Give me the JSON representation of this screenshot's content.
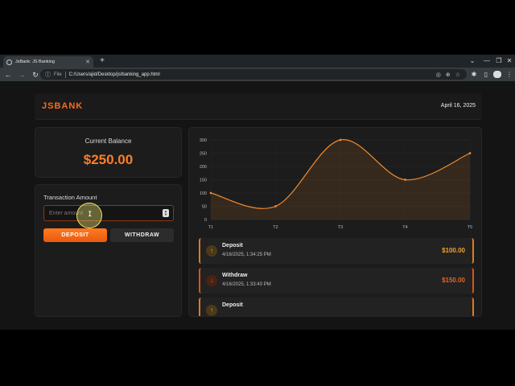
{
  "browser": {
    "tab_title": "JsBank: JS Banking",
    "scheme": "File",
    "url": "C:/Users/ajid/Desktop/js/banking_app.html"
  },
  "header": {
    "brand": "JSBANK",
    "date": "April 16, 2025"
  },
  "balance": {
    "label": "Current Balance",
    "value": "$250.00"
  },
  "transaction_form": {
    "label": "Transaction Amount",
    "placeholder": "Enter amount",
    "deposit_label": "DEPOSIT",
    "withdraw_label": "WITHDRAW"
  },
  "chart_data": {
    "type": "line",
    "x": [
      "T1",
      "T2",
      "T3",
      "T4",
      "T5"
    ],
    "values": [
      100,
      50,
      300,
      150,
      250
    ],
    "yticks": [
      "0",
      "50",
      "100",
      "150",
      "200",
      "250",
      "300"
    ],
    "ylim": [
      0,
      300
    ],
    "grid": true,
    "color": "#f08a2e"
  },
  "transactions": [
    {
      "type": "Deposit",
      "time": "4/16/2025, 1:34:25 PM",
      "amount": "$100.00",
      "kind": "deposit",
      "icon": "arrow-up-icon"
    },
    {
      "type": "Withdraw",
      "time": "4/16/2025, 1:33:40 PM",
      "amount": "$150.00",
      "kind": "withdraw",
      "icon": "arrow-down-icon"
    },
    {
      "type": "Deposit",
      "time": "",
      "amount": "",
      "kind": "deposit",
      "icon": "arrow-up-icon"
    }
  ]
}
